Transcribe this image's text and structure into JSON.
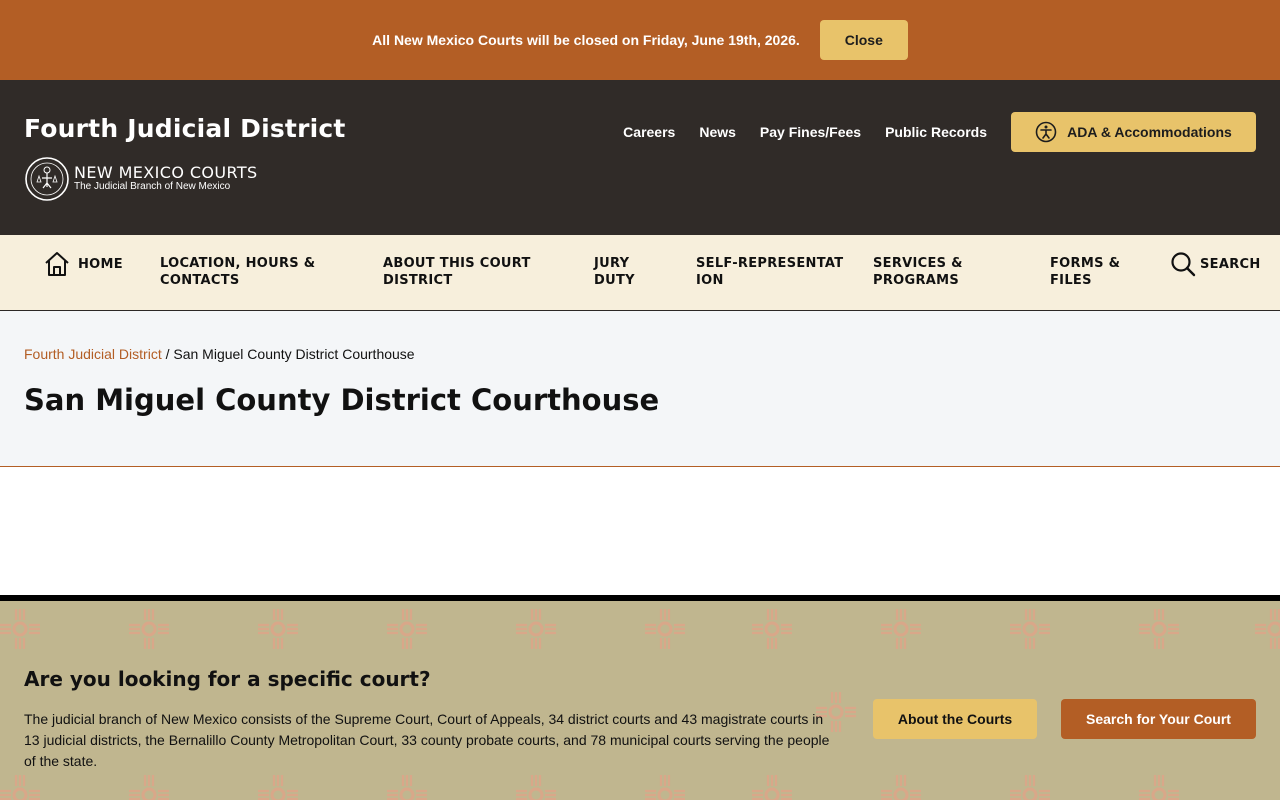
{
  "alert": {
    "message": "All New Mexico Courts will be closed on Friday, June 19th, 2026.",
    "close_label": "Close"
  },
  "header": {
    "site_title": "Fourth Judicial District",
    "logo_name": "NEW MEXICO COURTS",
    "logo_tagline": "The Judicial Branch of New Mexico",
    "utility_links": [
      "Careers",
      "News",
      "Pay Fines/Fees",
      "Public Records"
    ],
    "ada_label": "ADA & Accommodations"
  },
  "nav": {
    "home": "HOME",
    "items": [
      "LOCATION, HOURS & CONTACTS",
      "ABOUT THIS COURT DISTRICT",
      "JURY DUTY",
      "SELF-REPRESENTATION",
      "SERVICES & PROGRAMS",
      "FORMS & FILES"
    ],
    "search": "SEARCH"
  },
  "page": {
    "breadcrumb_link": "Fourth Judicial District",
    "breadcrumb_sep": " / ",
    "breadcrumb_current": "San Miguel County District Courthouse",
    "title": "San Miguel County District Courthouse"
  },
  "promo": {
    "title": "Are you looking for a specific court?",
    "body": "The judicial branch of New Mexico consists of the Supreme Court, Court of Appeals, 34 district courts and 43 magistrate courts in 13 judicial districts, the Bernalillo County Metropolitan Court, 33 county probate courts, and 78 municipal courts serving the people of the state.",
    "about_label": "About the Courts",
    "search_label": "Search for Your Court"
  },
  "colors": {
    "brand_orange": "#b35e25",
    "gold": "#e8c36a",
    "header_dark": "#302b28",
    "nav_cream": "#f7efdc",
    "promo_tan": "#c0b68f"
  }
}
